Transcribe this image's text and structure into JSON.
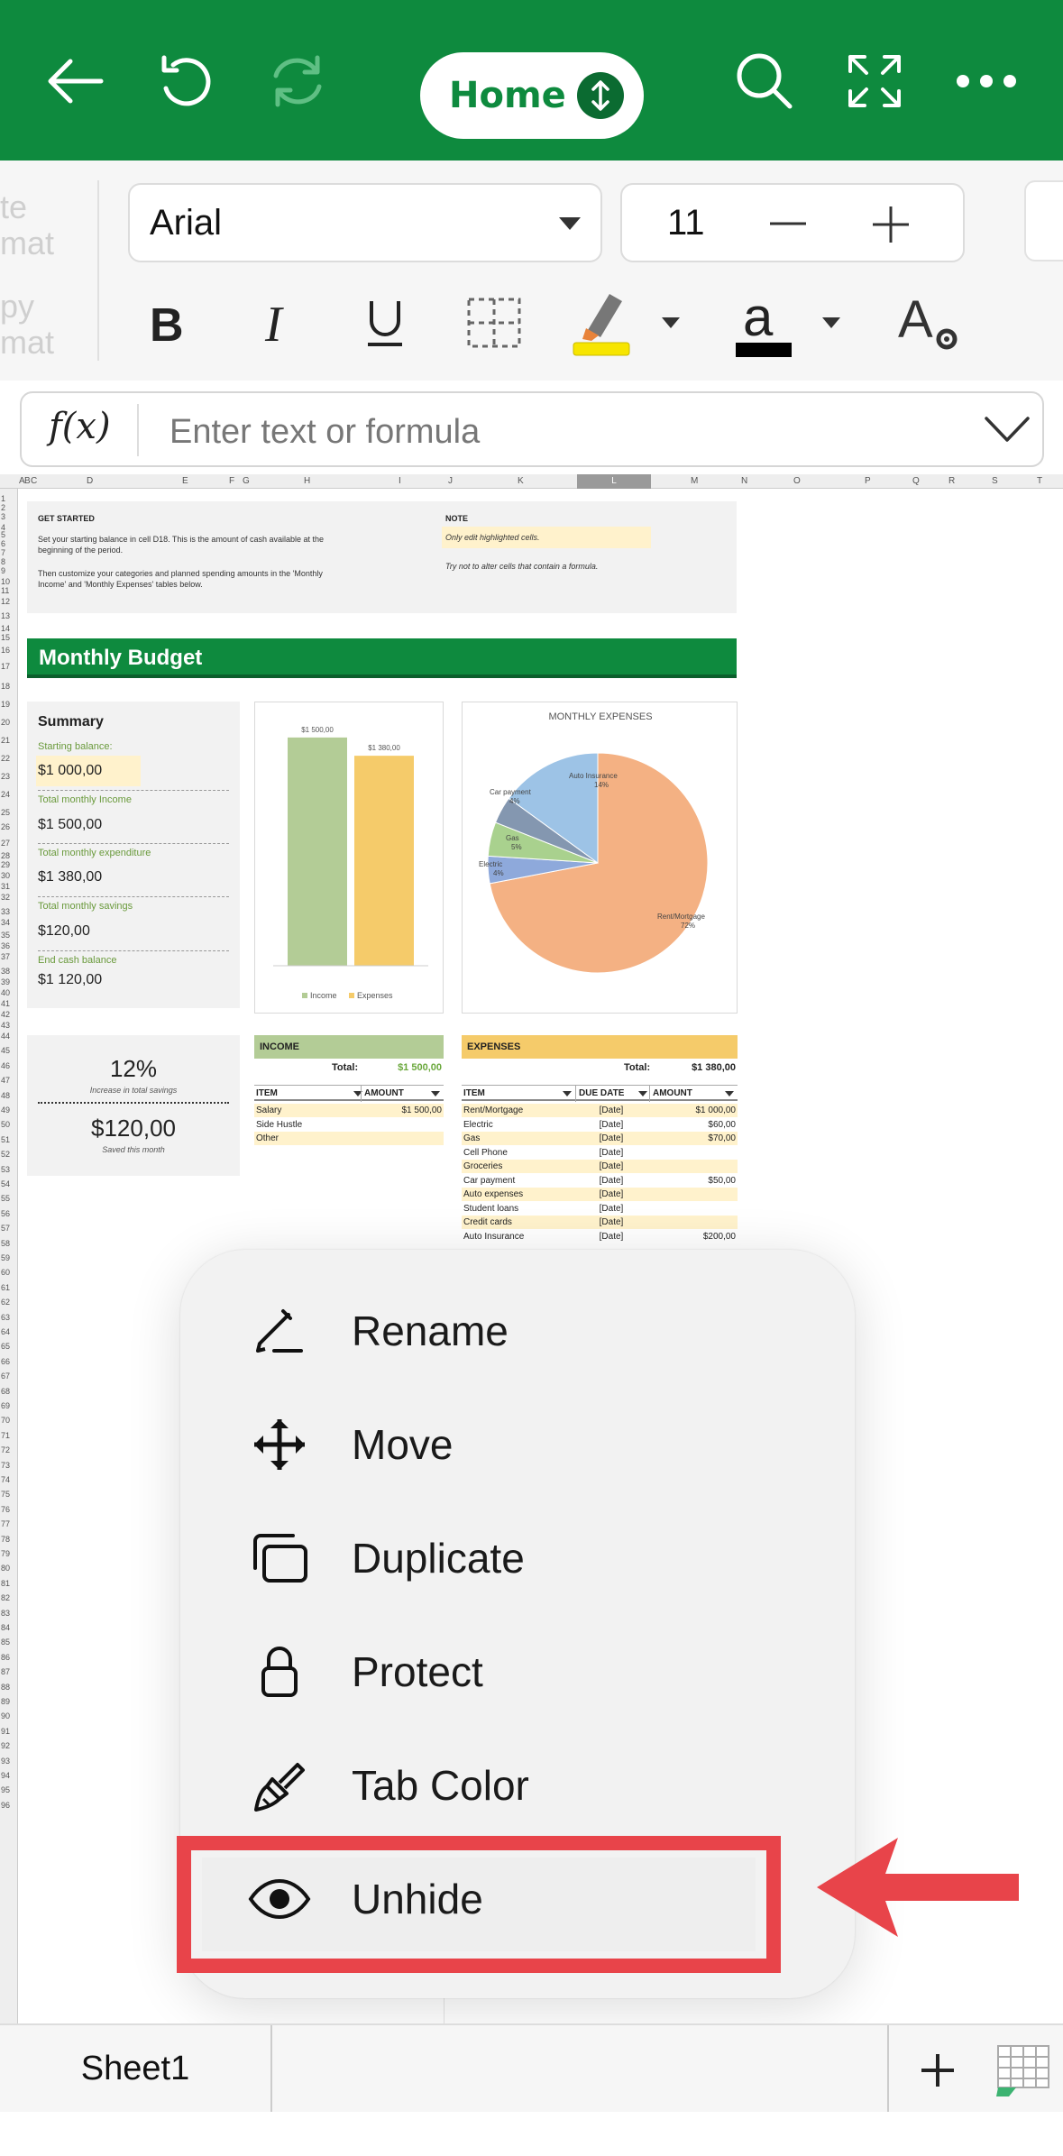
{
  "topbar": {
    "home_label": "Home",
    "icons": [
      "back-arrow-icon",
      "undo-icon",
      "redo-icon",
      "search-icon",
      "fullscreen-icon",
      "more-icon"
    ],
    "color": "#0e8a3e"
  },
  "ribbon": {
    "ghost_1": "te",
    "ghost_2": "mat",
    "ghost_3": "py",
    "ghost_4": "mat",
    "font_name": "Arial",
    "font_size": "11",
    "highlight_color": "#f7e500",
    "font_color": "#000000"
  },
  "formula": {
    "fx_label": "f(x)",
    "placeholder": "Enter text or formula"
  },
  "sheet": {
    "columns": [
      "A",
      "B",
      "C",
      "D",
      "E",
      "F",
      "G",
      "H",
      "I",
      "J",
      "K",
      "L",
      "M",
      "N",
      "O",
      "P",
      "Q",
      "R",
      "S",
      "T"
    ],
    "get_started": {
      "title": "GET STARTED",
      "line1": "Set your starting balance in cell D18. This is the amount of cash available at the",
      "line2": "beginning of the period.",
      "line3": "Then customize your categories and planned spending amounts in the 'Monthly",
      "line4": "Income' and 'Monthly Expenses' tables below."
    },
    "note": {
      "title": "NOTE",
      "highlight": "Only edit highlighted cells.",
      "line": "Try not to alter cells that contain a formula."
    },
    "banner_title": "Monthly Budget",
    "summary": {
      "title": "Summary",
      "starting_label": "Starting balance:",
      "starting_value": "$1 000,00",
      "income_label": "Total monthly Income",
      "income_value": "$1 500,00",
      "expenditure_label": "Total monthly expenditure",
      "expenditure_value": "$1 380,00",
      "savings_label": "Total monthly savings",
      "savings_value": "$120,00",
      "end_label": "End cash balance",
      "end_value": "$1 120,00"
    },
    "savings_box": {
      "percent": "12%",
      "percent_label": "Increase in total savings",
      "amount": "$120,00",
      "amount_label": "Saved this month"
    },
    "income_table": {
      "title": "INCOME",
      "total_label": "Total:",
      "total_value": "$1 500,00",
      "col_item": "ITEM",
      "col_amount": "AMOUNT",
      "rows": [
        {
          "item": "Salary",
          "amount": "$1 500,00"
        },
        {
          "item": "Side Hustle",
          "amount": ""
        },
        {
          "item": "Other",
          "amount": ""
        }
      ]
    },
    "expenses_table": {
      "title": "EXPENSES",
      "total_label": "Total:",
      "total_value": "$1 380,00",
      "col_item": "ITEM",
      "col_due": "DUE DATE",
      "col_amount": "AMOUNT",
      "rows": [
        {
          "item": "Rent/Mortgage",
          "due": "[Date]",
          "amount": "$1 000,00"
        },
        {
          "item": "Electric",
          "due": "[Date]",
          "amount": "$60,00"
        },
        {
          "item": "Gas",
          "due": "[Date]",
          "amount": "$70,00"
        },
        {
          "item": "Cell Phone",
          "due": "[Date]",
          "amount": ""
        },
        {
          "item": "Groceries",
          "due": "[Date]",
          "amount": ""
        },
        {
          "item": "Car payment",
          "due": "[Date]",
          "amount": "$50,00"
        },
        {
          "item": "Auto expenses",
          "due": "[Date]",
          "amount": ""
        },
        {
          "item": "Student loans",
          "due": "[Date]",
          "amount": ""
        },
        {
          "item": "Credit cards",
          "due": "[Date]",
          "amount": ""
        },
        {
          "item": "Auto Insurance",
          "due": "[Date]",
          "amount": "$200,00"
        }
      ]
    }
  },
  "chart_data": [
    {
      "type": "bar",
      "categories": [
        "Income",
        "Expenses"
      ],
      "values": [
        1500,
        1380
      ],
      "value_labels": [
        "$1 500,00",
        "$1 380,00"
      ],
      "legend": [
        "Income",
        "Expenses"
      ],
      "legend_position": "bottom",
      "colors": [
        "#b3cc96",
        "#f5cb6a"
      ],
      "ylim": [
        0,
        1600
      ]
    },
    {
      "type": "pie",
      "title": "MONTHLY EXPENSES",
      "slices": [
        {
          "label": "Rent/Mortgage",
          "pct": "72%",
          "value": 72,
          "color": "#f4b183"
        },
        {
          "label": "Electric",
          "pct": "4%",
          "value": 4,
          "color": "#8ea9db"
        },
        {
          "label": "Gas",
          "pct": "5%",
          "value": 5,
          "color": "#a9d18e"
        },
        {
          "label": "Car payment",
          "pct": "4%",
          "value": 4,
          "color": "#8497b0"
        },
        {
          "label": "Auto Insurance",
          "pct": "14%",
          "value": 15,
          "color": "#9dc3e6"
        }
      ]
    }
  ],
  "menu": {
    "items": [
      {
        "label": "Rename",
        "icon": "rename-pen-icon"
      },
      {
        "label": "Move",
        "icon": "move-arrows-icon"
      },
      {
        "label": "Duplicate",
        "icon": "duplicate-icon"
      },
      {
        "label": "Protect",
        "icon": "lock-icon"
      },
      {
        "label": "Tab Color",
        "icon": "paintbrush-icon"
      },
      {
        "label": "Unhide",
        "icon": "eye-icon"
      }
    ],
    "highlight_color": "#e8444a"
  },
  "bottombar": {
    "sheet_tab": "Sheet1"
  }
}
